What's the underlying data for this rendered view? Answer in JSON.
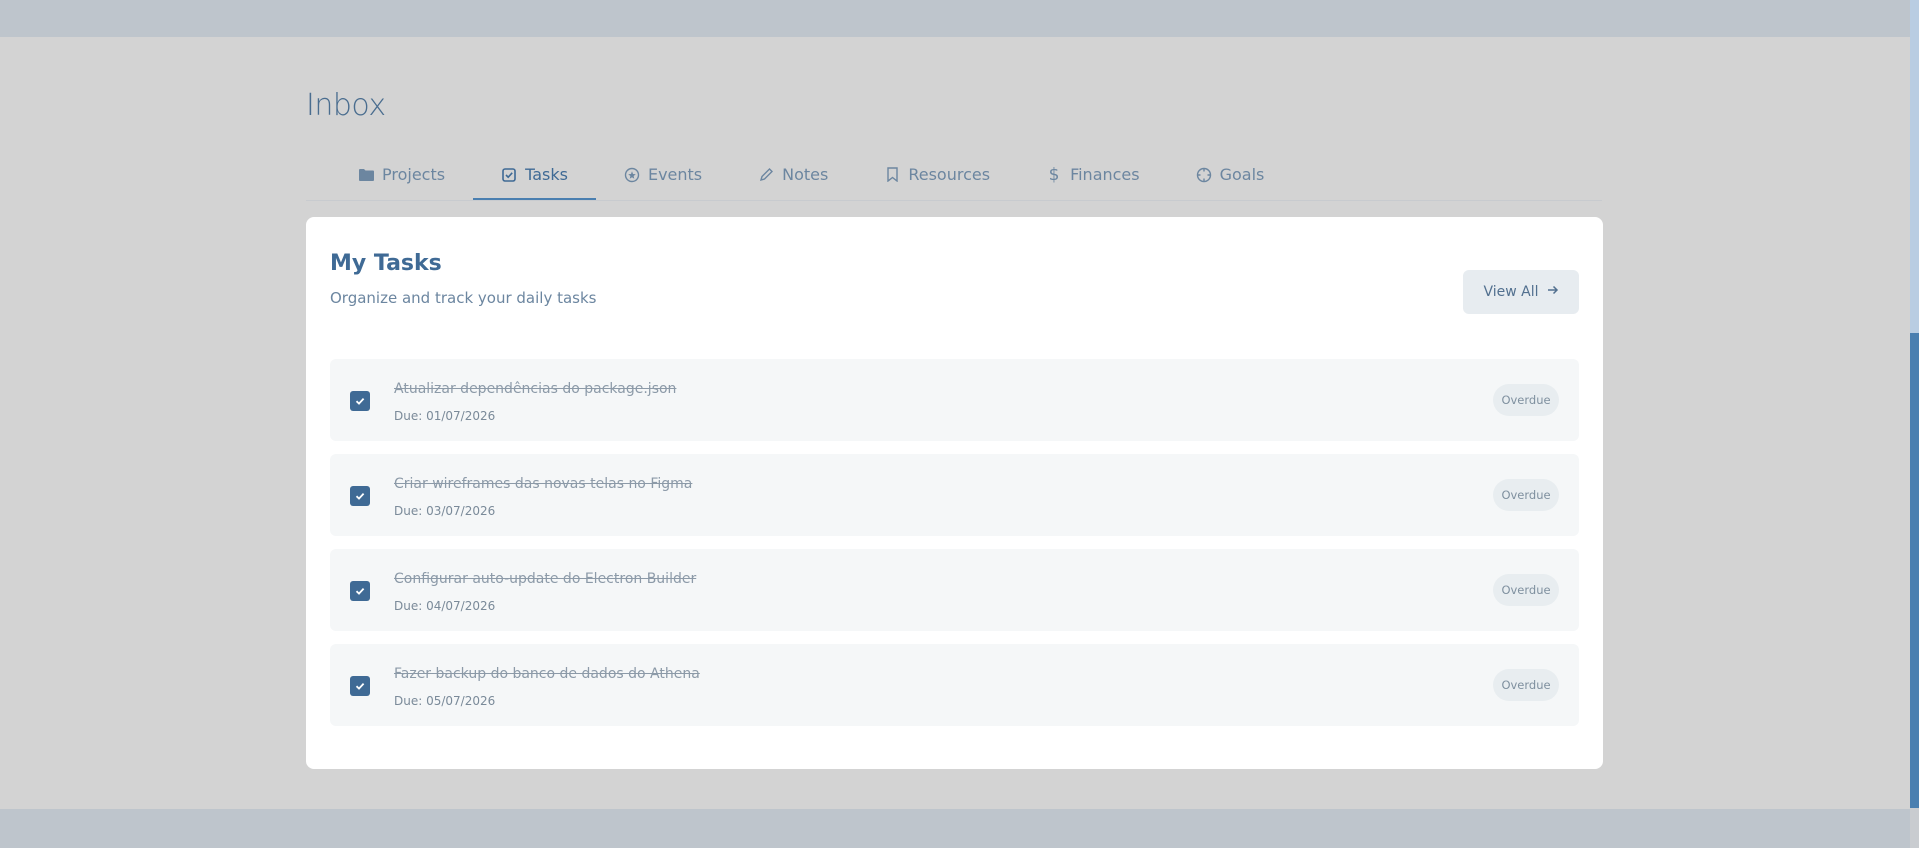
{
  "page": {
    "title": "Inbox"
  },
  "tabs": [
    {
      "label": "Projects",
      "icon": "folder-icon",
      "active": false
    },
    {
      "label": "Tasks",
      "icon": "checkbox-icon",
      "active": true
    },
    {
      "label": "Events",
      "icon": "events-icon",
      "active": false
    },
    {
      "label": "Notes",
      "icon": "pencil-icon",
      "active": false
    },
    {
      "label": "Resources",
      "icon": "bookmark-icon",
      "active": false
    },
    {
      "label": "Finances",
      "icon": "dollar-icon",
      "active": false
    },
    {
      "label": "Goals",
      "icon": "target-icon",
      "active": false
    }
  ],
  "card": {
    "title": "My Tasks",
    "subtitle": "Organize and track your daily tasks",
    "view_all_label": "View All",
    "tasks": [
      {
        "title": "Atualizar dependências do package.json",
        "due": "Due: 01/07/2026",
        "status": "Overdue",
        "completed": true
      },
      {
        "title": "Criar wireframes das novas telas no Figma",
        "due": "Due: 03/07/2026",
        "status": "Overdue",
        "completed": true
      },
      {
        "title": "Configurar auto-update do Electron Builder",
        "due": "Due: 04/07/2026",
        "status": "Overdue",
        "completed": true
      },
      {
        "title": "Fazer backup do banco de dados do Athena",
        "due": "Due: 05/07/2026",
        "status": "Overdue",
        "completed": true
      }
    ]
  },
  "colors": {
    "accent": "#4a7fb0",
    "overlay_bg": "#d3d3d3",
    "card_bg": "#ffffff"
  }
}
